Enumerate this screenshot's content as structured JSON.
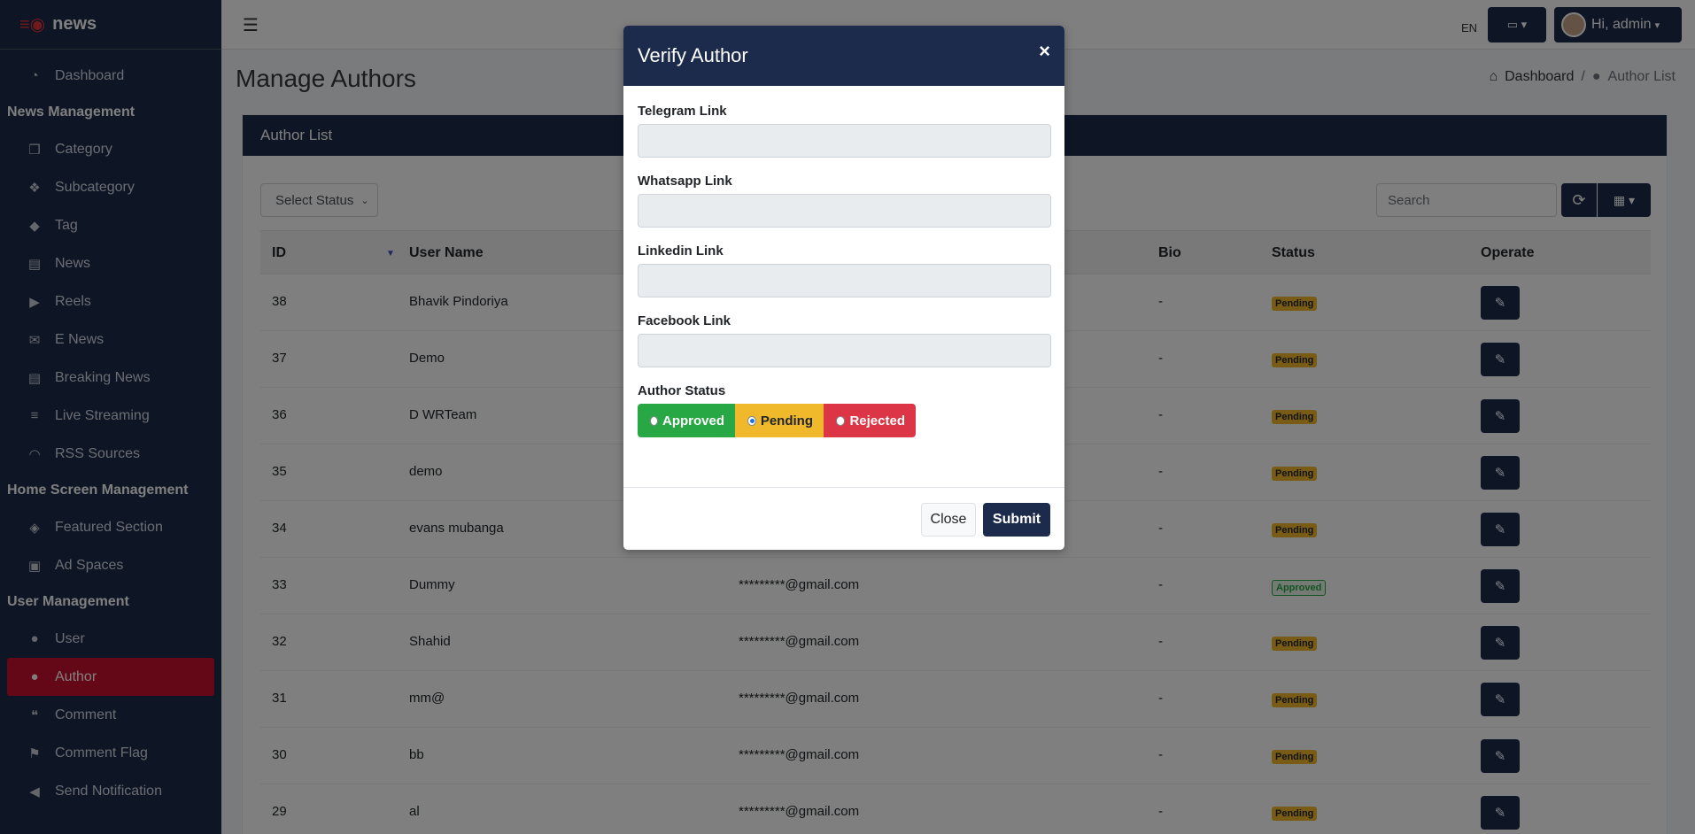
{
  "brand": {
    "name": "news"
  },
  "sidebar": {
    "items": [
      {
        "type": "item",
        "label": "Dashboard",
        "icon": "dashboard-icon",
        "glyph": "◔"
      },
      {
        "type": "section",
        "label": "News Management"
      },
      {
        "type": "item",
        "label": "Category",
        "icon": "cube-icon",
        "glyph": "❒"
      },
      {
        "type": "item",
        "label": "Subcategory",
        "icon": "cubes-icon",
        "glyph": "❖"
      },
      {
        "type": "item",
        "label": "Tag",
        "icon": "tag-icon",
        "glyph": "◆"
      },
      {
        "type": "item",
        "label": "News",
        "icon": "newspaper-icon",
        "glyph": "▤"
      },
      {
        "type": "item",
        "label": "Reels",
        "icon": "play-circle-icon",
        "glyph": "▶"
      },
      {
        "type": "item",
        "label": "E News",
        "icon": "envelope-icon",
        "glyph": "✉"
      },
      {
        "type": "item",
        "label": "Breaking News",
        "icon": "list-alt-icon",
        "glyph": "▤"
      },
      {
        "type": "item",
        "label": "Live Streaming",
        "icon": "stream-icon",
        "glyph": "≡"
      },
      {
        "type": "item",
        "label": "RSS Sources",
        "icon": "rss-icon",
        "glyph": "◠"
      },
      {
        "type": "section",
        "label": "Home Screen Management"
      },
      {
        "type": "item",
        "label": "Featured Section",
        "icon": "layers-icon",
        "glyph": "◈"
      },
      {
        "type": "item",
        "label": "Ad Spaces",
        "icon": "ad-icon",
        "glyph": "▣"
      },
      {
        "type": "section",
        "label": "User Management"
      },
      {
        "type": "item",
        "label": "User",
        "icon": "user-icon",
        "glyph": "●"
      },
      {
        "type": "item",
        "label": "Author",
        "icon": "user-tie-icon",
        "glyph": "●",
        "active": true
      },
      {
        "type": "item",
        "label": "Comment",
        "icon": "comments-icon",
        "glyph": "❝"
      },
      {
        "type": "item",
        "label": "Comment Flag",
        "icon": "flag-icon",
        "glyph": "⚑"
      },
      {
        "type": "item",
        "label": "Send Notification",
        "icon": "bullhorn-icon",
        "glyph": "◀"
      }
    ]
  },
  "topbar": {
    "lang_label": "EN",
    "user_greeting": "Hi, admin"
  },
  "page": {
    "title": "Manage Authors",
    "breadcrumb": {
      "home": "Dashboard",
      "separator": "/",
      "current": "Author List"
    }
  },
  "card": {
    "header": "Author List",
    "filter_select": "Select Status",
    "search_placeholder": "Search"
  },
  "table": {
    "headers": [
      "ID",
      "User Name",
      "Bio",
      "Status",
      "Operate"
    ],
    "rows": [
      {
        "id": "38",
        "name": "Bhavik Pindoriya",
        "email": "",
        "bio": "-",
        "status": "Pending"
      },
      {
        "id": "37",
        "name": "Demo",
        "email": "",
        "bio": "-",
        "status": "Pending"
      },
      {
        "id": "36",
        "name": "D WRTeam",
        "email": "",
        "bio": "-",
        "status": "Pending"
      },
      {
        "id": "35",
        "name": "demo",
        "email": "",
        "bio": "-",
        "status": "Pending"
      },
      {
        "id": "34",
        "name": "evans mubanga",
        "email": "",
        "bio": "-",
        "status": "Pending"
      },
      {
        "id": "33",
        "name": "Dummy",
        "email": "*********@gmail.com",
        "bio": "-",
        "status": "Approved"
      },
      {
        "id": "32",
        "name": "Shahid",
        "email": "*********@gmail.com",
        "bio": "-",
        "status": "Pending"
      },
      {
        "id": "31",
        "name": "mm@",
        "email": "*********@gmail.com",
        "bio": "-",
        "status": "Pending"
      },
      {
        "id": "30",
        "name": "bb",
        "email": "*********@gmail.com",
        "bio": "-",
        "status": "Pending"
      },
      {
        "id": "29",
        "name": "al",
        "email": "*********@gmail.com",
        "bio": "-",
        "status": "Pending"
      }
    ]
  },
  "modal": {
    "title": "Verify Author",
    "close_x": "×",
    "fields": {
      "telegram": {
        "label": "Telegram Link",
        "value": ""
      },
      "whatsapp": {
        "label": "Whatsapp Link",
        "value": ""
      },
      "linkedin": {
        "label": "Linkedin Link",
        "value": ""
      },
      "facebook": {
        "label": "Facebook Link",
        "value": ""
      }
    },
    "status_label": "Author Status",
    "status_options": {
      "approved": "Approved",
      "pending": "Pending",
      "rejected": "Rejected"
    },
    "selected_status": "Pending",
    "close_button": "Close",
    "submit_button": "Submit"
  },
  "colors": {
    "navy": "#1c2b4b",
    "active_red": "#c8102e",
    "approved_green": "#28a745",
    "pending_yellow": "#f0b92b",
    "rejected_red": "#dc3545"
  }
}
